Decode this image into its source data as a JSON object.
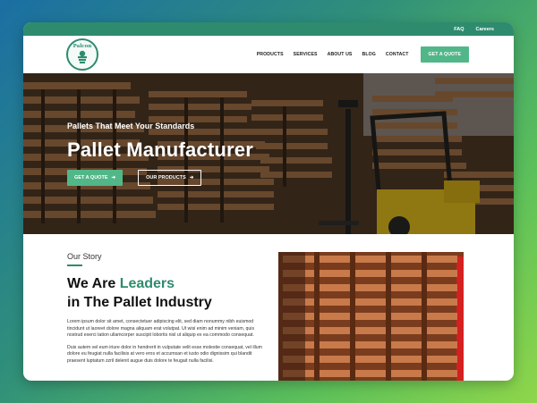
{
  "topbar": {
    "faq": "FAQ",
    "careers": "Careers"
  },
  "logo": {
    "text": "Palcon"
  },
  "nav": {
    "items": [
      "PRODUCTS",
      "SERVICES",
      "ABOUT US",
      "BLOG",
      "CONTACT"
    ],
    "cta": "GET A QUOTE"
  },
  "hero": {
    "subtitle": "Pallets That Meet Your Standards",
    "title": "Pallet Manufacturer",
    "btn_quote": "GET A QUOTE",
    "btn_products": "OUR PRODUCTS"
  },
  "story": {
    "kicker": "Our Story",
    "title_prefix": "We Are ",
    "title_highlight": "Leaders",
    "title_line2": "in The Pallet Industry",
    "para1": "Lorem ipsum dolor sit amet, consectetuer adipiscing elit, sed diam nonummy nibh euismod tincidunt ut laoreet dolore magna aliquam erat volutpat. Ut wisi enim ad minim veniam, quis nostrud exerci tation ullamcorper suscipit lobortis nisl ut aliquip ex ea commodo consequat.",
    "para2": "Duis autem vel eum iriure dolor in hendrerit in vulputate velit esse molestie consequat, vel illum dolore eu feugiat nulla facilisis at vero eros et accumsan et iusto odio dignissim qui blandit praesent luptatum zzril delenit augue duis dolore te feugait nulla facilisi."
  },
  "colors": {
    "brand": "#2e8b6e",
    "accent": "#52b788",
    "red": "#d42020"
  }
}
